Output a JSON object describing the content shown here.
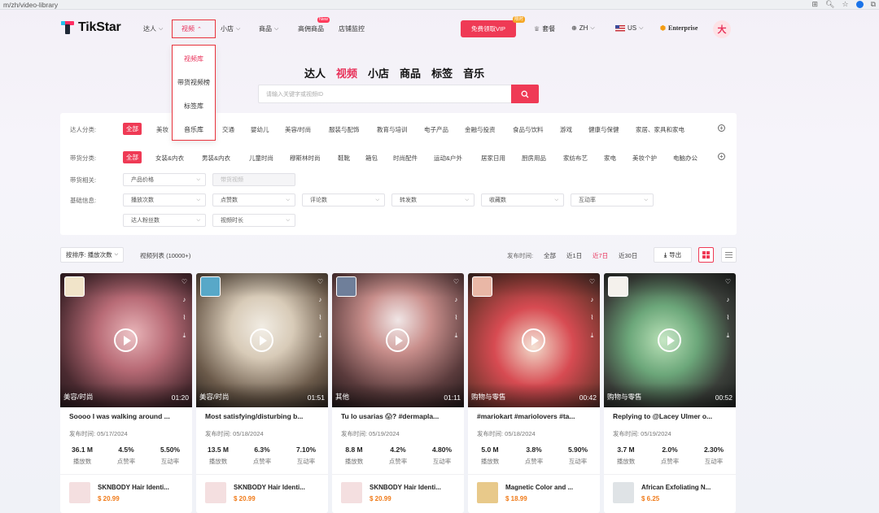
{
  "browser": {
    "url": "m/zh/video-library"
  },
  "brand": {
    "name": "TikStar",
    "accent": "#ef3a55"
  },
  "nav": {
    "items": [
      "达人",
      "视频",
      "小店",
      "商品",
      "高佣商品",
      "店铺监控"
    ],
    "new_badge": "New",
    "vip_button": "免费领取VIP",
    "vip_badge": "限时",
    "plan": "套餐",
    "language": "ZH",
    "region": "US",
    "enterprise": "Enterprise",
    "avatar_initial": "大"
  },
  "video_menu": [
    "视频库",
    "带货视频榜",
    "标签库",
    "音乐库"
  ],
  "category_tabs": [
    "达人",
    "视频",
    "小店",
    "商品",
    "标签",
    "音乐"
  ],
  "search": {
    "placeholder": "请输入关键字或视频ID"
  },
  "filters": {
    "creator_category": {
      "label": "达人分类:",
      "options": [
        "全部",
        "美妆",
        "交通",
        "婴幼儿",
        "美容/时尚",
        "服装与配饰",
        "教育与培训",
        "电子产品",
        "金融与投资",
        "食品与饮料",
        "游戏",
        "健康与保健",
        "家居、家具和家电"
      ]
    },
    "product_category": {
      "label": "带货分类:",
      "options": [
        "全部",
        "女装&内衣",
        "男装&内衣",
        "儿童时尚",
        "穆斯林时尚",
        "鞋靴",
        "箱包",
        "时尚配件",
        "运动&户外",
        "居家日用",
        "厨房用品",
        "家纺布艺",
        "家电",
        "美妆个护",
        "电脑办公"
      ]
    },
    "product_related": {
      "label": "带货相关:",
      "selects": [
        "产品价格",
        "带货视频"
      ]
    },
    "basic_info": {
      "label": "基础信息:",
      "selects": [
        "播放次数",
        "点赞数",
        "评论数",
        "转发数",
        "收藏数",
        "互动率",
        "达人粉丝数",
        "视频时长"
      ]
    }
  },
  "toolbar": {
    "sort": "按排序: 播放次数",
    "count": "视频列表 (10000+)",
    "publish_time_label": "发布时间:",
    "time_options": [
      "全部",
      "近1日",
      "近7日",
      "近30日"
    ],
    "export": "导出"
  },
  "videos": [
    {
      "title": "Soooo I was walking around ...",
      "category": "美容/时尚",
      "duration": "01:20",
      "date": "发布时间: 05/17/2024",
      "plays": "36.1 M",
      "like_rate": "4.5%",
      "engagement": "5.50%",
      "product": "SKNBODY Hair Identi...",
      "price": "$ 20.99"
    },
    {
      "title": "Most satisfying/disturbing b...",
      "category": "美容/时尚",
      "duration": "01:51",
      "date": "发布时间: 05/18/2024",
      "plays": "13.5 M",
      "like_rate": "6.3%",
      "engagement": "7.10%",
      "product": "SKNBODY Hair Identi...",
      "price": "$ 20.99"
    },
    {
      "title": "Tu lo usarias 😱? #dermapla...",
      "category": "其他",
      "duration": "01:11",
      "date": "发布时间: 05/19/2024",
      "plays": "8.8 M",
      "like_rate": "4.2%",
      "engagement": "4.80%",
      "product": "SKNBODY Hair Identi...",
      "price": "$ 20.99"
    },
    {
      "title": "#mariokart #mariolovers #ta...",
      "category": "购物与零售",
      "duration": "00:42",
      "date": "发布时间: 05/18/2024",
      "plays": "5.0 M",
      "like_rate": "3.8%",
      "engagement": "5.90%",
      "product": "Magnetic Color and ...",
      "price": "$ 18.99"
    },
    {
      "title": "Replying to @Lacey Ulmer o...",
      "category": "购物与零售",
      "duration": "00:52",
      "date": "发布时间: 05/19/2024",
      "plays": "3.7 M",
      "like_rate": "2.0%",
      "engagement": "2.30%",
      "product": "African Exfoliating N...",
      "price": "$ 6.25"
    }
  ],
  "stat_labels": {
    "plays": "播放数",
    "like_rate": "点赞率",
    "engagement": "互动率"
  }
}
